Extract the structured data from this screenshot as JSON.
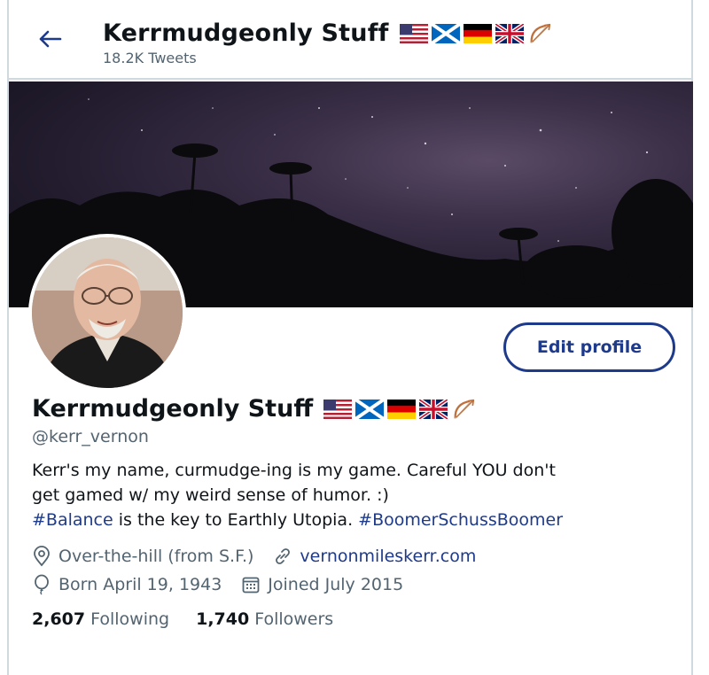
{
  "header": {
    "title": "Kerrmudgeonly Stuff",
    "tweet_count": "18.2K Tweets",
    "back_icon": "arrow-left-icon"
  },
  "profile": {
    "name": "Kerrmudgeonly Stuff",
    "handle": "@kerr_vernon",
    "flags": [
      "us-flag-icon",
      "scotland-flag-icon",
      "germany-flag-icon",
      "uk-flag-icon",
      "bow-and-arrow-icon"
    ],
    "edit_label": "Edit profile",
    "bio": {
      "line1": "Kerr's my name, curmudge-ing is my game. Careful YOU don't",
      "line2": "get gamed w/ my weird sense of humor. :)",
      "hashtag1": "#Balance",
      "middle": " is the key to Earthly Utopia. ",
      "hashtag2": "#BoomerSchussBoomer"
    },
    "location": "Over-the-hill (from S.F.)",
    "website": "vernonmileskerr.com",
    "birthday": "Born April 19, 1943",
    "joined": "Joined July 2015",
    "following_count": "2,607",
    "following_label": "Following",
    "followers_count": "1,740",
    "followers_label": "Followers"
  },
  "colors": {
    "accent": "#1e3a8a",
    "secondary_text": "#536471",
    "border": "#cfd9de"
  }
}
